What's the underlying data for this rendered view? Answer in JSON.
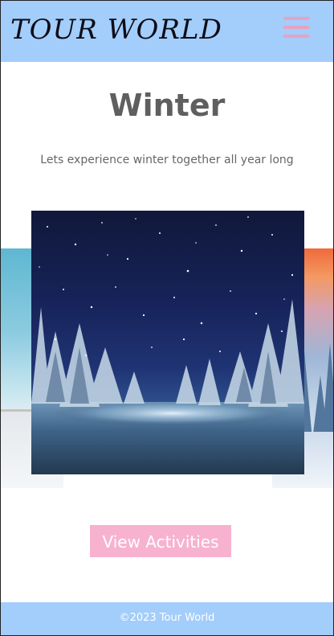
{
  "header": {
    "logo_text": "TOUR WORLD",
    "menu_icon": "hamburger-menu-icon"
  },
  "main": {
    "title": "Winter",
    "subtitle": "Lets experience winter together all year long"
  },
  "carousel": {
    "slides": [
      {
        "name": "snowy-field-slide"
      },
      {
        "name": "night-snow-forest-slide"
      },
      {
        "name": "sunset-snow-trees-slide"
      }
    ],
    "active_index": 1
  },
  "actions": {
    "view_activities_label": "View Activities"
  },
  "footer": {
    "copyright": "©2023 Tour World"
  },
  "colors": {
    "header_bg": "#a3cdfa",
    "footer_bg": "#a3cdfa",
    "accent_pink": "#f7b2cf",
    "menu_icon": "#e7a2c4",
    "title_text": "#5f5f5f"
  }
}
